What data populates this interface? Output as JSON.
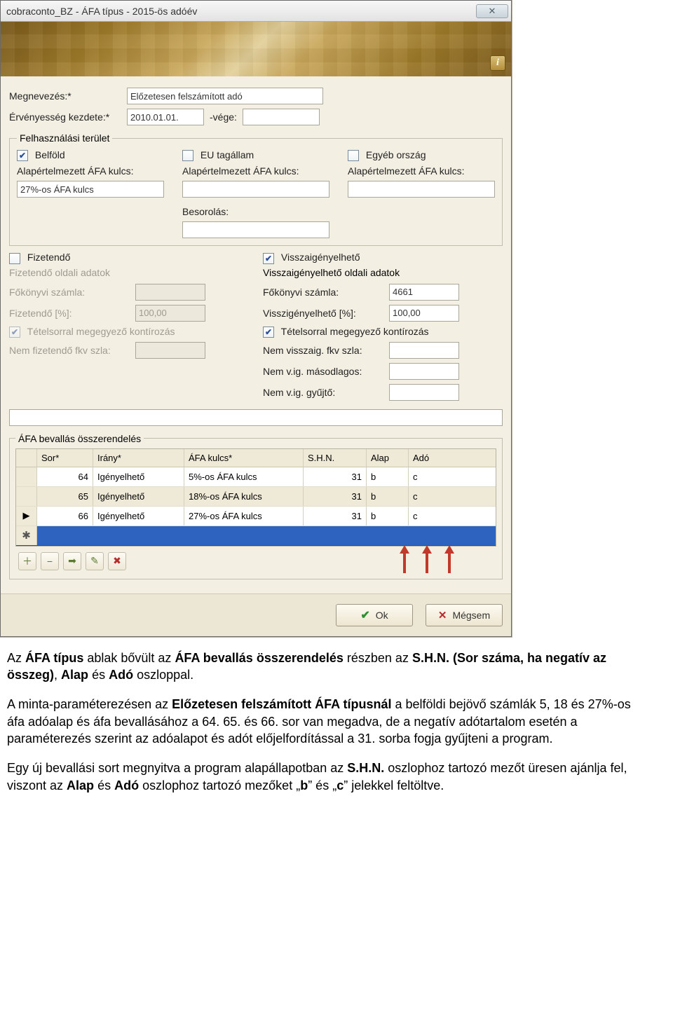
{
  "window": {
    "title": "cobraconto_BZ - ÁFA típus - 2015-ös adóév"
  },
  "ribbon": {
    "info_label": "i"
  },
  "header": {
    "name_label": "Megnevezés:*",
    "name_value": "Előzetesen felszámított adó",
    "valid_from_label": "Érvényesség kezdete:*",
    "valid_from_value": "2010.01.01.",
    "valid_to_label": "-vége:",
    "valid_to_value": ""
  },
  "usage": {
    "legend": "Felhasználási terület",
    "domestic_label": "Belföld",
    "domestic_checked": true,
    "eu_label": "EU tagállam",
    "eu_checked": false,
    "other_label": "Egyéb ország",
    "other_checked": false,
    "defkey_label": "Alapértelmezett ÁFA kulcs:",
    "domestic_key": "27%-os ÁFA kulcs",
    "eu_key": "",
    "other_key": "",
    "class_label": "Besorolás:",
    "class_value": ""
  },
  "payable": {
    "check_label": "Fizetendő",
    "checked": false,
    "heading": "Fizetendő oldali adatok",
    "ledger_label": "Főkönyvi számla:",
    "ledger_value": "",
    "percent_label": "Fizetendő [%]:",
    "percent_value": "100,00",
    "sameline_label": "Tételsorral megegyező kontírozás",
    "sameline_checked": true,
    "notpay_label": "Nem fizetendő fkv szla:",
    "notpay_value": ""
  },
  "reclaim": {
    "check_label": "Visszaigényelhető",
    "checked": true,
    "heading": "Visszaigényelhető oldali adatok",
    "ledger_label": "Főkönyvi számla:",
    "ledger_value": "4661",
    "percent_label": "Visszigényelhető [%]:",
    "percent_value": "100,00",
    "sameline_label": "Tételsorral megegyező kontírozás",
    "sameline_checked": true,
    "novig_label": "Nem visszaig. fkv szla:",
    "novig_value": "",
    "sec_label": "Nem v.ig. másodlagos:",
    "sec_value": "",
    "coll_label": "Nem v.ig. gyűjtő:",
    "coll_value": ""
  },
  "mapping": {
    "legend": "ÁFA bevallás összerendelés",
    "cols": {
      "sor": "Sor*",
      "irany": "Irány*",
      "kulcs": "ÁFA kulcs*",
      "shn": "S.H.N.",
      "alap": "Alap",
      "ado": "Adó"
    },
    "rows": [
      {
        "sor": "64",
        "irany": "Igényelhető",
        "kulcs": "5%-os ÁFA kulcs",
        "shn": "31",
        "alap": "b",
        "ado": "c"
      },
      {
        "sor": "65",
        "irany": "Igényelhető",
        "kulcs": "18%-os ÁFA kulcs",
        "shn": "31",
        "alap": "b",
        "ado": "c"
      },
      {
        "sor": "66",
        "irany": "Igényelhető",
        "kulcs": "27%-os ÁFA kulcs",
        "shn": "31",
        "alap": "b",
        "ado": "c"
      }
    ],
    "newrow_marker": "✱"
  },
  "buttons": {
    "ok": "Ok",
    "cancel": "Mégsem"
  },
  "doc": {
    "p1a": "Az ",
    "p1b": "ÁFA típus",
    "p1c": " ablak bővült az ",
    "p1d": "ÁFA bevallás összerendelés",
    "p1e": " részben az ",
    "p1f": "S.H.N.",
    "p1g": " (Sor száma, ha negatív az összeg)",
    "p1h": ", ",
    "p1i": "Alap",
    "p1j": " és ",
    "p1k": "Adó",
    "p1l": " oszloppal.",
    "p2a": "A minta-paraméterezésen az ",
    "p2b": "Előzetesen felszámított ÁFA típusnál",
    "p2c": " a belföldi bejövő számlák 5, 18 és 27%-os áfa adóalap és áfa bevallásához a 64. 65. és 66. sor van megadva, de a negatív adótartalom esetén a paraméterezés szerint az adóalapot és adót előjelfordítással a 31. sorba fogja gyűjteni a program.",
    "p3a": "Egy új bevallási sort megnyitva a program alapállapotban az ",
    "p3b": "S.H.N.",
    "p3c": " oszlophoz tartozó mezőt üresen ajánlja fel, viszont az ",
    "p3d": "Alap",
    "p3e": " és ",
    "p3f": "Adó",
    "p3g": " oszlophoz tartozó mezőket „",
    "p3h": "b",
    "p3i": "” és „",
    "p3j": "c",
    "p3k": "” jelekkel feltöltve."
  },
  "icons": {
    "add": "＋",
    "del": "−",
    "fwd": "➡",
    "edit": "✎",
    "delx": "✖"
  }
}
